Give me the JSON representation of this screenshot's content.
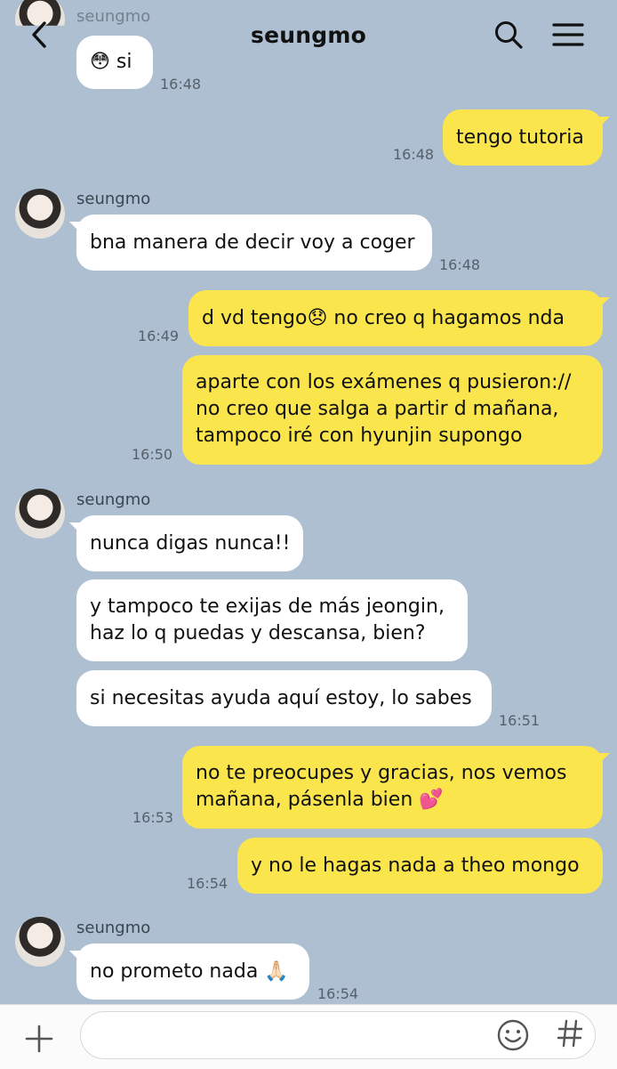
{
  "header": {
    "title": "seungmo"
  },
  "messages": {
    "top_sender": "seungmo",
    "top_text": "😳 si",
    "top_time": "16:48",
    "m1": {
      "text": "tengo tutoria",
      "time": "16:48"
    },
    "g1": {
      "sender": "seungmo",
      "text": "bna manera de decir voy a coger",
      "time": "16:48"
    },
    "m2": {
      "text": "d vd tengo😞  no creo q hagamos nda",
      "time": "16:49"
    },
    "m3": {
      "line1": "aparte con los exámenes q pusieron://",
      "line2": "no creo que salga a partir d mañana,",
      "line3": "tampoco iré con hyunjin supongo",
      "time": "16:50"
    },
    "g2": {
      "sender": "seungmo",
      "text1": "nunca digas nunca!!",
      "text2_line1": "y tampoco te exijas de más jeongin,",
      "text2_line2": "haz lo q puedas y descansa, bien?",
      "text3": "si necesitas ayuda aquí estoy, lo sabes",
      "time": "16:51"
    },
    "m4": {
      "line1": "no te preocupes y gracias, nos vemos",
      "line2": "mañana, pásenla bien 💕",
      "time": "16:53"
    },
    "m5": {
      "text": "y no le hagas nada a theo mongo",
      "time": "16:54"
    },
    "g3": {
      "sender": "seungmo",
      "text": "no prometo nada 🙏🏻",
      "time": "16:54"
    }
  },
  "input": {
    "placeholder": ""
  },
  "icons": {
    "back": "chevron-left-icon",
    "search": "search-icon",
    "menu": "hamburger-menu-icon",
    "add": "plus-icon",
    "emoji": "smiley-icon",
    "hashtag": "hashtag-icon"
  },
  "colors": {
    "background": "#adbfd0",
    "outgoing_bubble": "#fae64c",
    "incoming_bubble": "#ffffff"
  }
}
